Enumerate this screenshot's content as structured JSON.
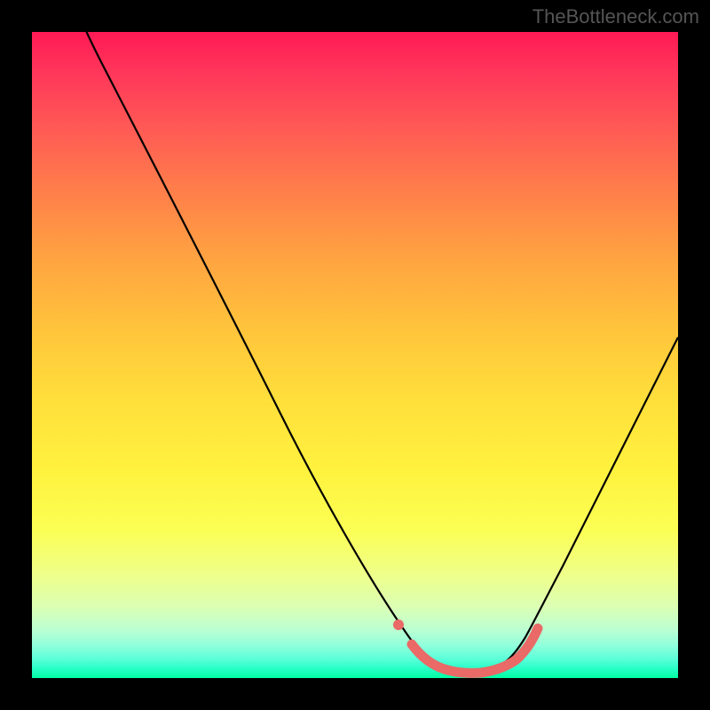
{
  "watermark": "TheBottleneck.com",
  "chart_data": {
    "type": "line",
    "title": "",
    "xlabel": "",
    "ylabel": "",
    "xlim": [
      0,
      100
    ],
    "ylim": [
      0,
      100
    ],
    "series": [
      {
        "name": "bottleneck-curve",
        "x": [
          0,
          8,
          16,
          24,
          32,
          40,
          48,
          56,
          58,
          62,
          66,
          70,
          74,
          78,
          82,
          88,
          94,
          100
        ],
        "y": [
          110,
          100,
          86,
          72,
          58,
          45,
          32,
          16,
          8,
          2,
          1,
          1,
          2,
          6,
          16,
          30,
          45,
          60
        ]
      },
      {
        "name": "optimal-marker",
        "x": [
          56
        ],
        "y": [
          8
        ]
      },
      {
        "name": "optimal-band",
        "x": [
          58,
          62,
          66,
          70,
          74,
          78
        ],
        "y": [
          4,
          1.5,
          1,
          1,
          2,
          8
        ]
      }
    ],
    "colors": {
      "curve": "#000000",
      "marker": "#e96a67",
      "band": "#e96a67",
      "gradient_top": "#ff1a55",
      "gradient_bottom": "#00ffa2"
    }
  }
}
